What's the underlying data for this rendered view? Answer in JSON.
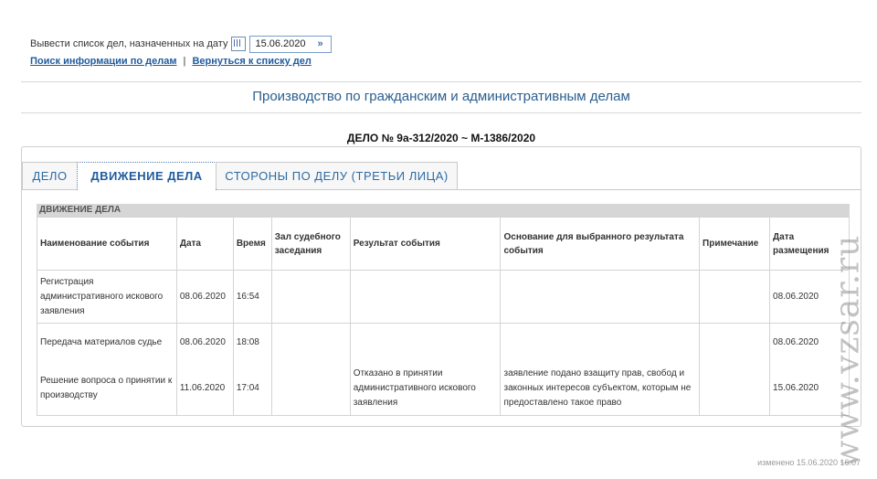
{
  "filter": {
    "label": "Вывести список дел, назначенных на дату",
    "date_value": "15.06.2020",
    "calendar_icon": "calendar-icon",
    "go_icon": "double-chevron-right-icon",
    "link_search": "Поиск информации по делам",
    "link_separator": "|",
    "link_back": "Вернуться к списку дел"
  },
  "section_title": "Производство по гражданским и административным делам",
  "case_number": "ДЕЛО № 9а-312/2020 ~ М-1386/2020",
  "tabs": [
    {
      "label": "ДЕЛО"
    },
    {
      "label": "ДВИЖЕНИЕ ДЕЛА"
    },
    {
      "label": "СТОРОНЫ ПО ДЕЛУ (ТРЕТЬИ ЛИЦА)"
    }
  ],
  "grid": {
    "caption": "ДВИЖЕНИЕ ДЕЛА",
    "columns": [
      "Наименование события",
      "Дата",
      "Время",
      "Зал судебного заседания",
      "Результат события",
      "Основание для выбранного результата события",
      "Примечание",
      "Дата размещения"
    ],
    "rows": [
      [
        "Регистрация административного искового заявления",
        "08.06.2020",
        "16:54",
        "",
        "",
        "",
        "",
        "08.06.2020"
      ],
      [
        "Передача материалов судье",
        "08.06.2020",
        "18:08",
        "",
        "",
        "",
        "",
        "08.06.2020"
      ],
      [
        "Решение вопроса о принятии к производству",
        "11.06.2020",
        "17:04",
        "",
        "Отказано в принятии административного искового заявления",
        "заявление подано взащиту прав, свобод и законных интересов субъектом, которым не предоставлено такое право",
        "",
        "15.06.2020"
      ]
    ]
  },
  "footer": "изменено 15.06.2020 16:07",
  "watermark": "www.vzsar.ru"
}
